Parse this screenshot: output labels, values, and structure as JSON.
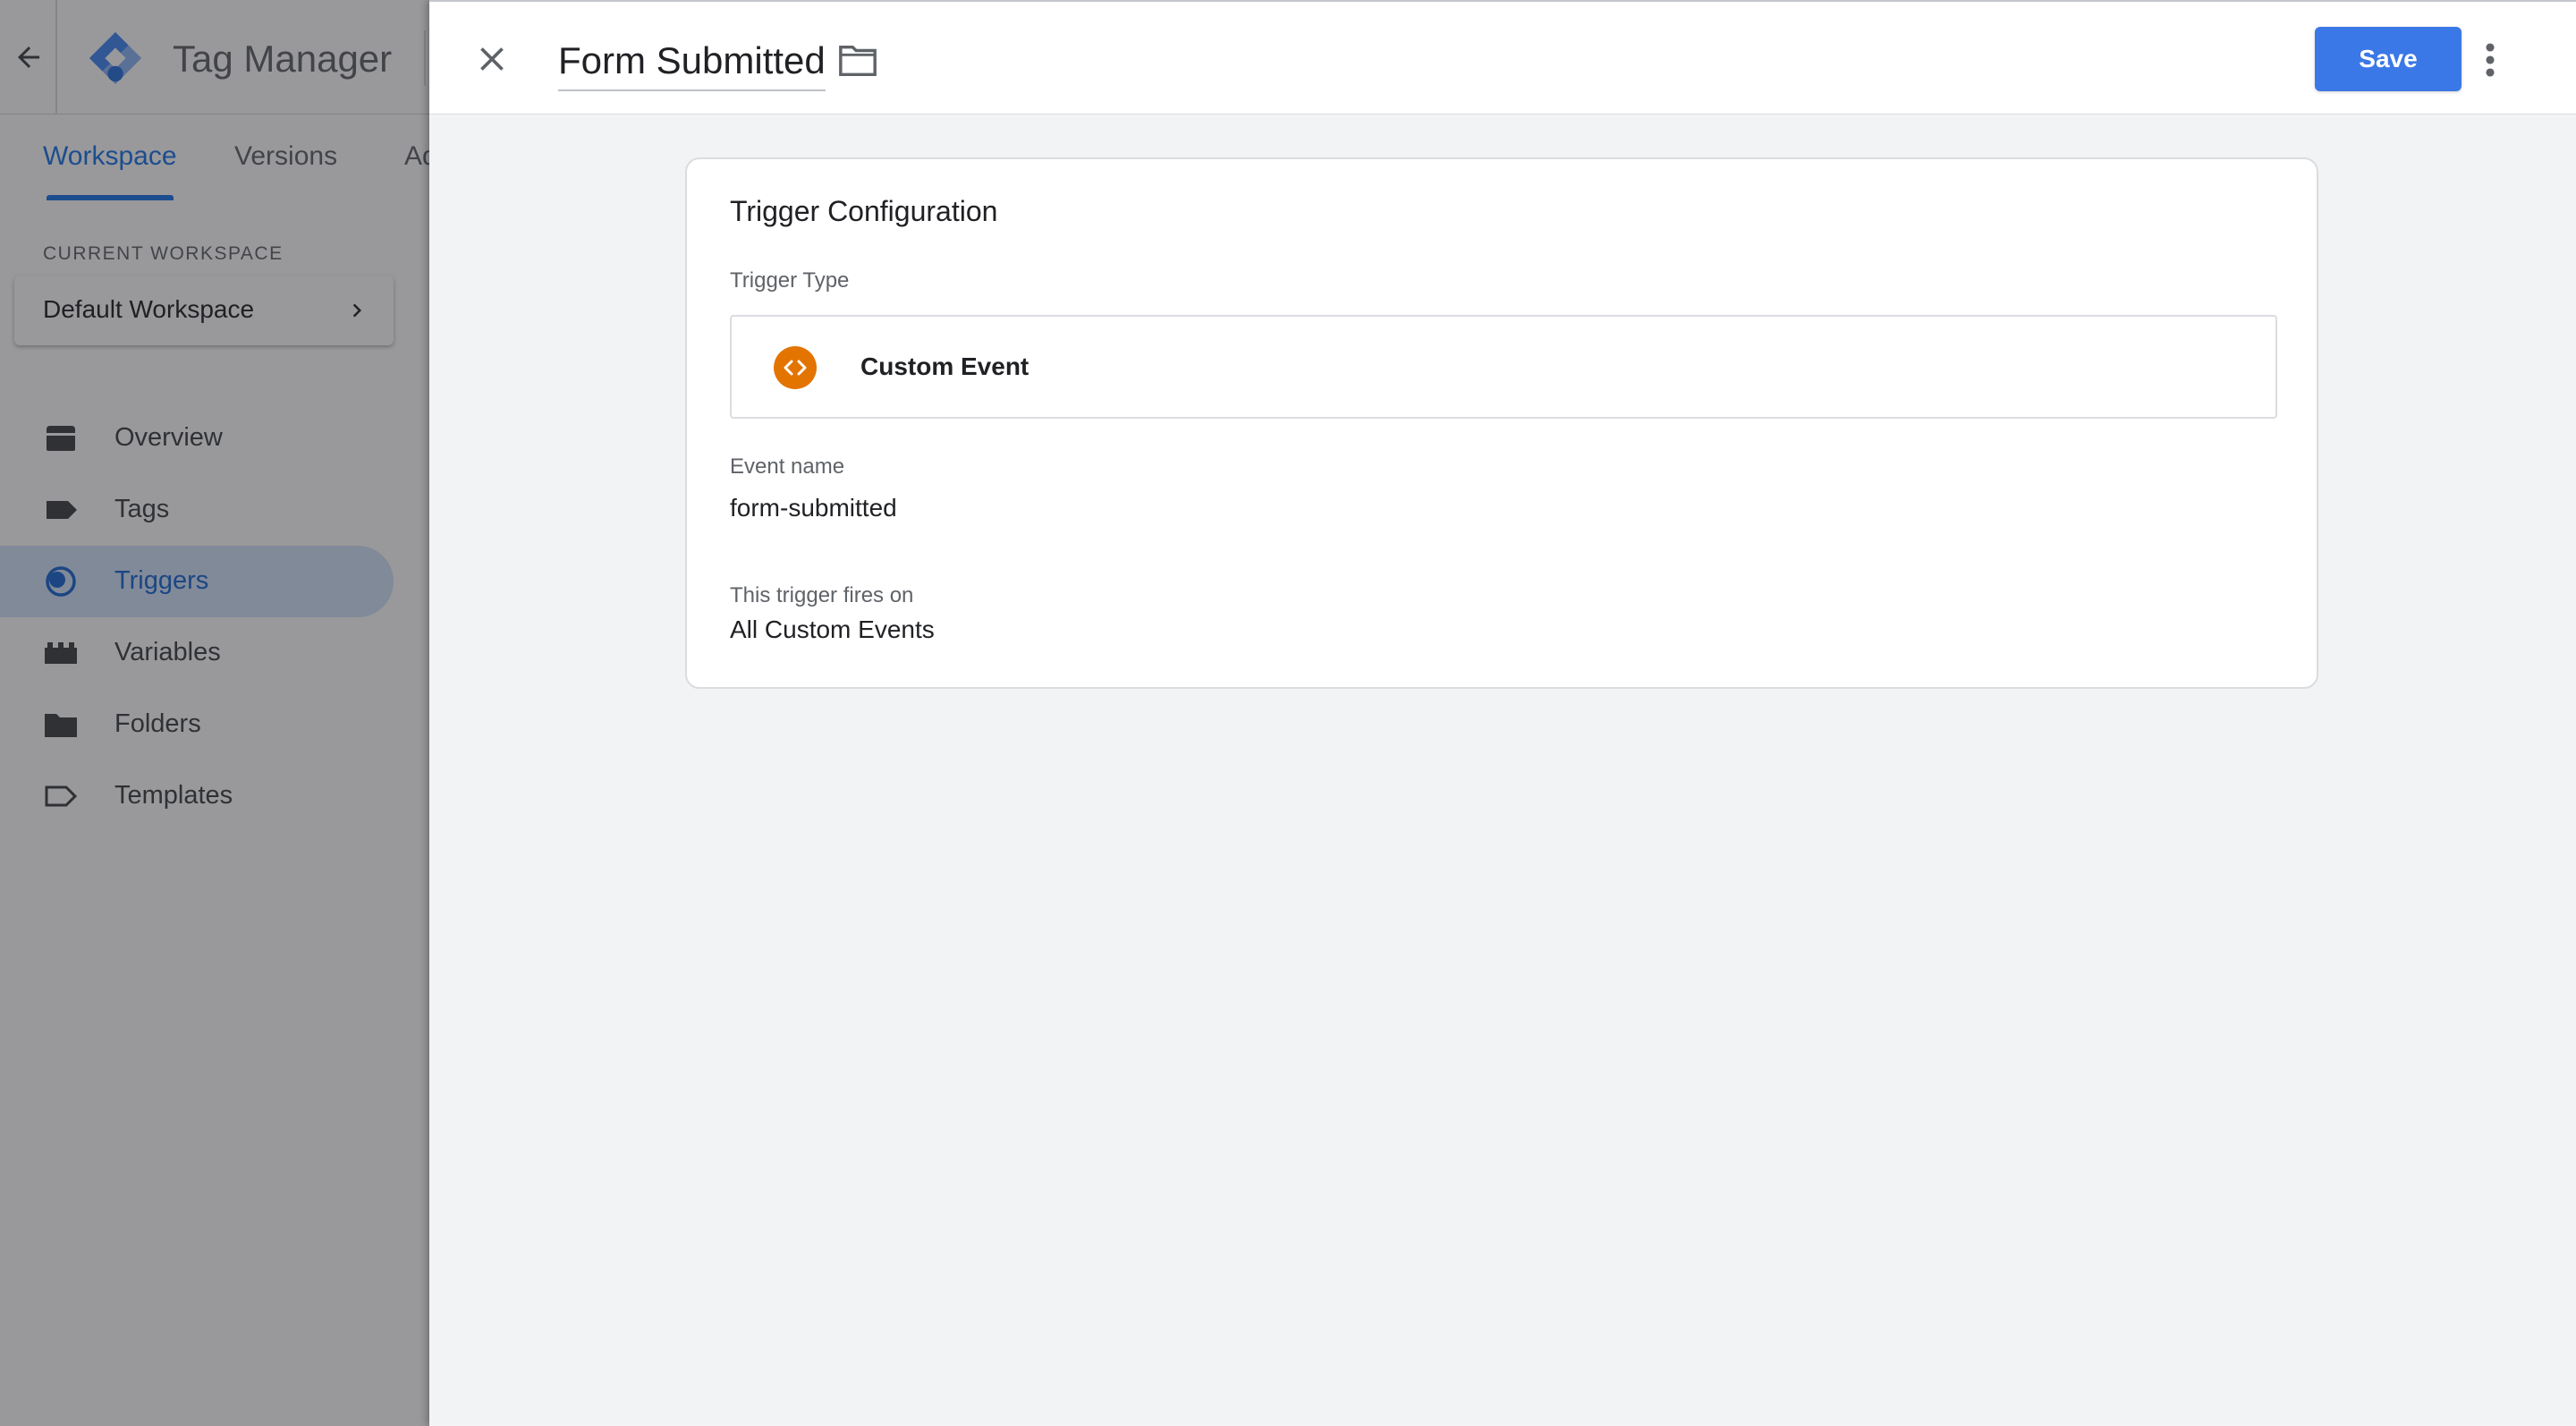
{
  "app": {
    "title": "Tag Manager"
  },
  "tabs": [
    {
      "label": "Workspace",
      "active": true
    },
    {
      "label": "Versions",
      "active": false
    },
    {
      "label": "Ad",
      "active": false
    }
  ],
  "workspace": {
    "section_label": "CURRENT WORKSPACE",
    "name": "Default Workspace"
  },
  "nav": [
    {
      "label": "Overview",
      "icon": "overview-icon",
      "active": false
    },
    {
      "label": "Tags",
      "icon": "tag-icon",
      "active": false
    },
    {
      "label": "Triggers",
      "icon": "trigger-icon",
      "active": true
    },
    {
      "label": "Variables",
      "icon": "variable-icon",
      "active": false
    },
    {
      "label": "Folders",
      "icon": "folder-icon",
      "active": false
    },
    {
      "label": "Templates",
      "icon": "template-icon",
      "active": false
    }
  ],
  "panel": {
    "name": "Form Submitted",
    "save_label": "Save"
  },
  "trigger": {
    "card_title": "Trigger Configuration",
    "type_label": "Trigger Type",
    "type_name": "Custom Event",
    "type_icon": "custom-event-icon",
    "event_name_label": "Event name",
    "event_name": "form-submitted",
    "fires_on_label": "This trigger fires on",
    "fires_on": "All Custom Events"
  },
  "colors": {
    "accent": "#1a73e8",
    "save_button": "#3b78e7",
    "custom_event_icon": "#e37400",
    "active_nav_bg": "#d2e3fc"
  }
}
